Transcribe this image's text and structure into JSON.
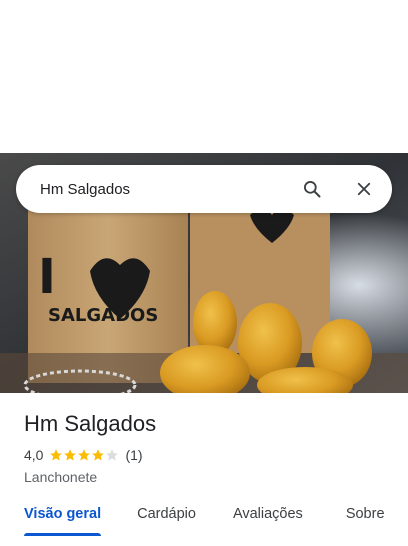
{
  "search": {
    "query": "Hm Salgados"
  },
  "place": {
    "name": "Hm Salgados",
    "rating": "4,0",
    "rating_value": 4,
    "rating_max": 5,
    "review_count": "(1)",
    "category": "Lanchonete"
  },
  "hero_photo": {
    "bag_print_heart": "I",
    "bag_print_brand": "SALGADOS"
  },
  "tabs": [
    {
      "label": "Visão geral",
      "active": true
    },
    {
      "label": "Cardápio",
      "active": false
    },
    {
      "label": "Avaliações",
      "active": false
    },
    {
      "label": "Sobre",
      "active": false
    }
  ],
  "colors": {
    "accent": "#0b57d0",
    "star": "#fbbc04",
    "star_empty": "#dadce0"
  },
  "icons": {
    "search": "search-icon",
    "close": "close-icon",
    "star": "star-icon"
  }
}
